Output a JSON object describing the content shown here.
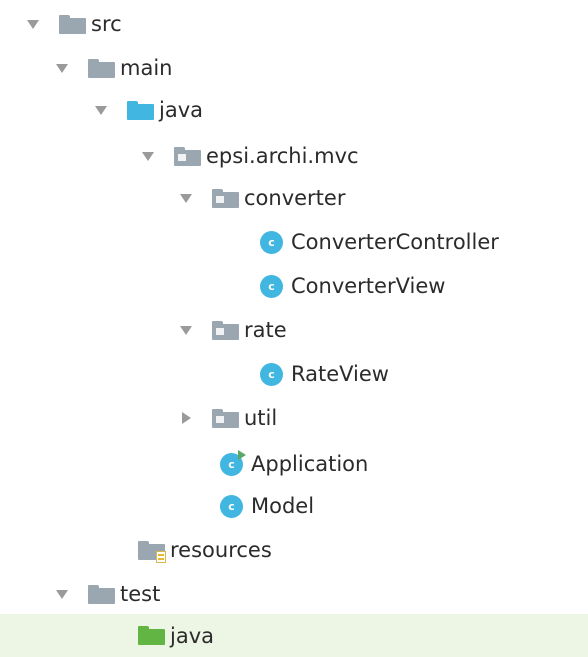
{
  "tree": [
    {
      "label": "src",
      "expanded": true,
      "icon": "folder-icon"
    },
    {
      "label": "main",
      "expanded": true,
      "icon": "folder-icon"
    },
    {
      "label": "java",
      "expanded": true,
      "icon": "source-root-folder-icon"
    },
    {
      "label": "epsi.archi.mvc",
      "expanded": true,
      "icon": "package-icon"
    },
    {
      "label": "converter",
      "expanded": true,
      "icon": "package-icon"
    },
    {
      "label": "ConverterController",
      "icon": "class-icon"
    },
    {
      "label": "ConverterView",
      "icon": "class-icon"
    },
    {
      "label": "rate",
      "expanded": true,
      "icon": "package-icon"
    },
    {
      "label": "RateView",
      "icon": "class-icon"
    },
    {
      "label": "util",
      "expanded": false,
      "icon": "package-icon"
    },
    {
      "label": "Application",
      "icon": "runnable-class-icon"
    },
    {
      "label": "Model",
      "icon": "class-icon"
    },
    {
      "label": "resources",
      "icon": "resources-folder-icon"
    },
    {
      "label": "test",
      "expanded": true,
      "icon": "folder-icon"
    },
    {
      "label": "java",
      "icon": "test-source-root-folder-icon",
      "selected": true
    }
  ],
  "class_badge_letter": "c",
  "colors": {
    "folder": "#9aa7b0",
    "source_root": "#40b6e0",
    "test_root": "#62b543",
    "class_icon": "#40b6e0",
    "selection": "#edf5e4"
  }
}
